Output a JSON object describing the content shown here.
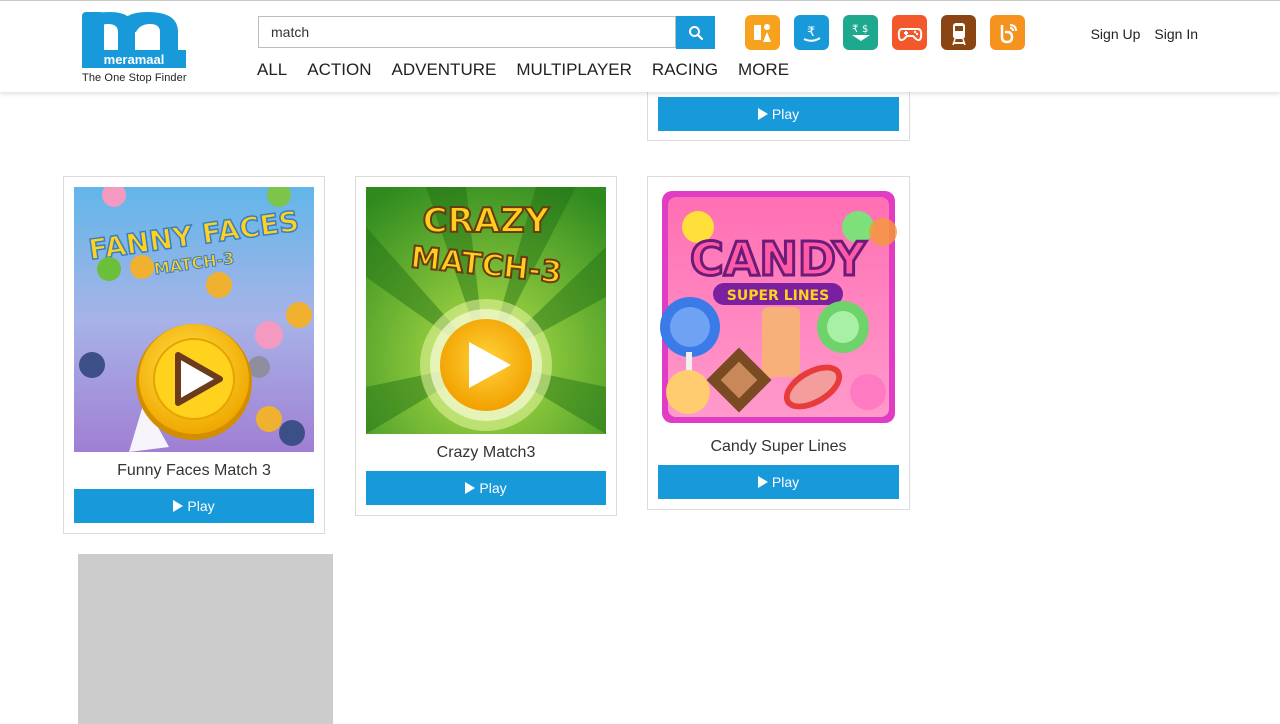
{
  "brand": {
    "name": "meramaal",
    "tagline": "The One Stop Finder",
    "color": "#1899da"
  },
  "search": {
    "value": "match",
    "button_icon": "search-icon"
  },
  "nav": [
    "ALL",
    "ACTION",
    "ADVENTURE",
    "MULTIPLAYER",
    "RACING",
    "MORE"
  ],
  "category_icons": [
    {
      "name": "jobs-icon",
      "color": "#f6a21e"
    },
    {
      "name": "rupee-icon",
      "color": "#1899da"
    },
    {
      "name": "currency-exchange-icon",
      "color": "#1ea88e"
    },
    {
      "name": "games-controller-icon",
      "color": "#f2582a"
    },
    {
      "name": "train-icon",
      "color": "#8b4513"
    },
    {
      "name": "blog-icon",
      "color": "#f6921e"
    }
  ],
  "auth": {
    "sign_up": "Sign Up",
    "sign_in": "Sign In"
  },
  "top_card": {
    "play_label": "Play"
  },
  "games": [
    {
      "title": "Funny Faces Match 3",
      "play_label": "Play",
      "art_title": "FANNY FACES",
      "art_subtitle": "MATCH-3"
    },
    {
      "title": "Crazy Match3",
      "play_label": "Play",
      "art_title": "CRAZY",
      "art_subtitle": "MATCH-3"
    },
    {
      "title": "Candy Super Lines",
      "play_label": "Play",
      "art_title": "CANDY",
      "art_subtitle": "SUPER LINES"
    }
  ]
}
